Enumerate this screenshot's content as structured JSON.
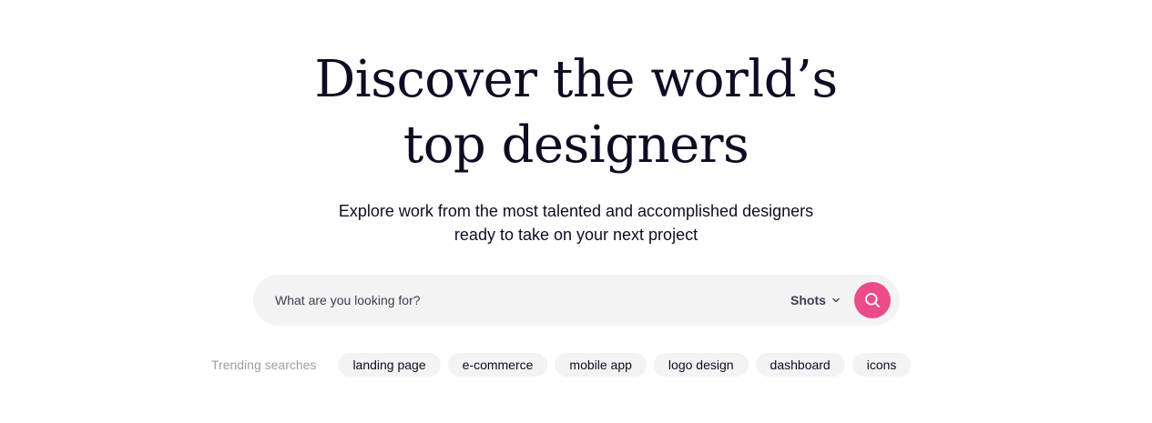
{
  "hero": {
    "headline_line1": "Discover the world’s",
    "headline_line2": "top designers",
    "subtitle_line1": "Explore work from the most talented and accomplished designers",
    "subtitle_line2": "ready to take on your next project"
  },
  "search": {
    "placeholder": "What are you looking for?",
    "value": "",
    "scope_label": "Shots",
    "scope_icon": "chevron-down-icon",
    "button_icon": "search-icon",
    "button_color": "#ea4c89"
  },
  "trending": {
    "label": "Trending searches",
    "tags": [
      {
        "label": "landing page"
      },
      {
        "label": "e-commerce"
      },
      {
        "label": "mobile app"
      },
      {
        "label": "logo design"
      },
      {
        "label": "dashboard"
      },
      {
        "label": "icons"
      }
    ]
  },
  "colors": {
    "text_primary": "#0d0c22",
    "text_muted": "#9e9ea7",
    "surface": "#f3f3f4",
    "accent": "#ea4c89"
  }
}
